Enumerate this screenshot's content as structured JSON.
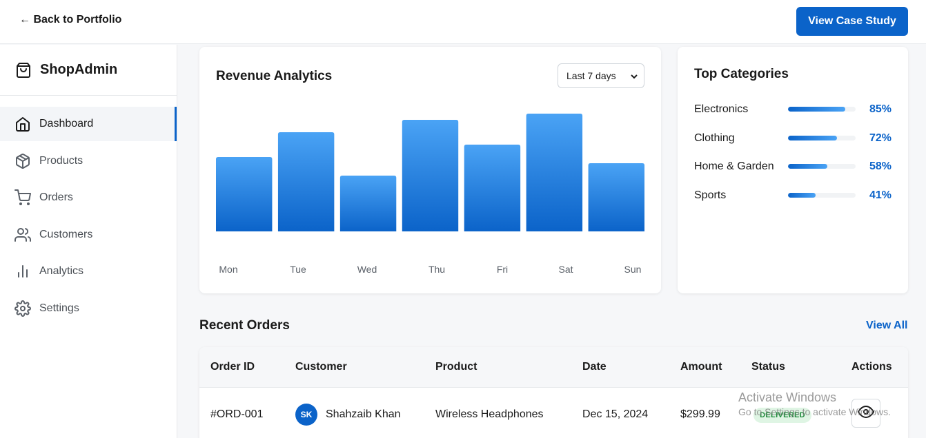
{
  "topbar": {
    "back_label": "← Back to Portfolio",
    "case_study_label": "View Case Study"
  },
  "brand": {
    "name": "ShopAdmin",
    "icon": "shopping-bag-icon"
  },
  "sidebar": {
    "items": [
      {
        "label": "Dashboard",
        "icon": "home-icon",
        "active": true
      },
      {
        "label": "Products",
        "icon": "package-icon",
        "active": false
      },
      {
        "label": "Orders",
        "icon": "cart-icon",
        "active": false
      },
      {
        "label": "Customers",
        "icon": "users-icon",
        "active": false
      },
      {
        "label": "Analytics",
        "icon": "bar-chart-icon",
        "active": false
      },
      {
        "label": "Settings",
        "icon": "gear-icon",
        "active": false
      }
    ]
  },
  "revenue": {
    "title": "Revenue Analytics",
    "range_selected": "Last 7 days"
  },
  "chart_data": {
    "type": "bar",
    "title": "Revenue Analytics",
    "categories": [
      "Mon",
      "Tue",
      "Wed",
      "Thu",
      "Fri",
      "Sat",
      "Sun"
    ],
    "values": [
      60,
      80,
      45,
      90,
      70,
      95,
      55
    ],
    "ylim": [
      0,
      100
    ],
    "grid": false,
    "legend": "none",
    "colors": {
      "top": "#4aa3f5",
      "bottom": "#0b63c9"
    }
  },
  "categories": {
    "title": "Top Categories",
    "items": [
      {
        "name": "Electronics",
        "percent": 85,
        "label": "85%"
      },
      {
        "name": "Clothing",
        "percent": 72,
        "label": "72%"
      },
      {
        "name": "Home & Garden",
        "percent": 58,
        "label": "58%"
      },
      {
        "name": "Sports",
        "percent": 41,
        "label": "41%"
      }
    ]
  },
  "orders": {
    "title": "Recent Orders",
    "view_all": "View All",
    "columns": [
      "Order ID",
      "Customer",
      "Product",
      "Date",
      "Amount",
      "Status",
      "Actions"
    ],
    "rows": [
      {
        "order_id": "#ORD-001",
        "initials": "SK",
        "customer": "Shahzaib Khan",
        "product": "Wireless Headphones",
        "date": "Dec 15, 2024",
        "amount": "$299.99",
        "status": "DELIVERED",
        "action_icon": "eye-icon"
      }
    ]
  },
  "watermark": {
    "line1": "Activate Windows",
    "line2": "Go to Settings to activate Windows."
  },
  "colors": {
    "accent": "#0b63c9",
    "status_delivered_bg": "#dff5e4",
    "status_delivered_text": "#1f8a3b"
  }
}
